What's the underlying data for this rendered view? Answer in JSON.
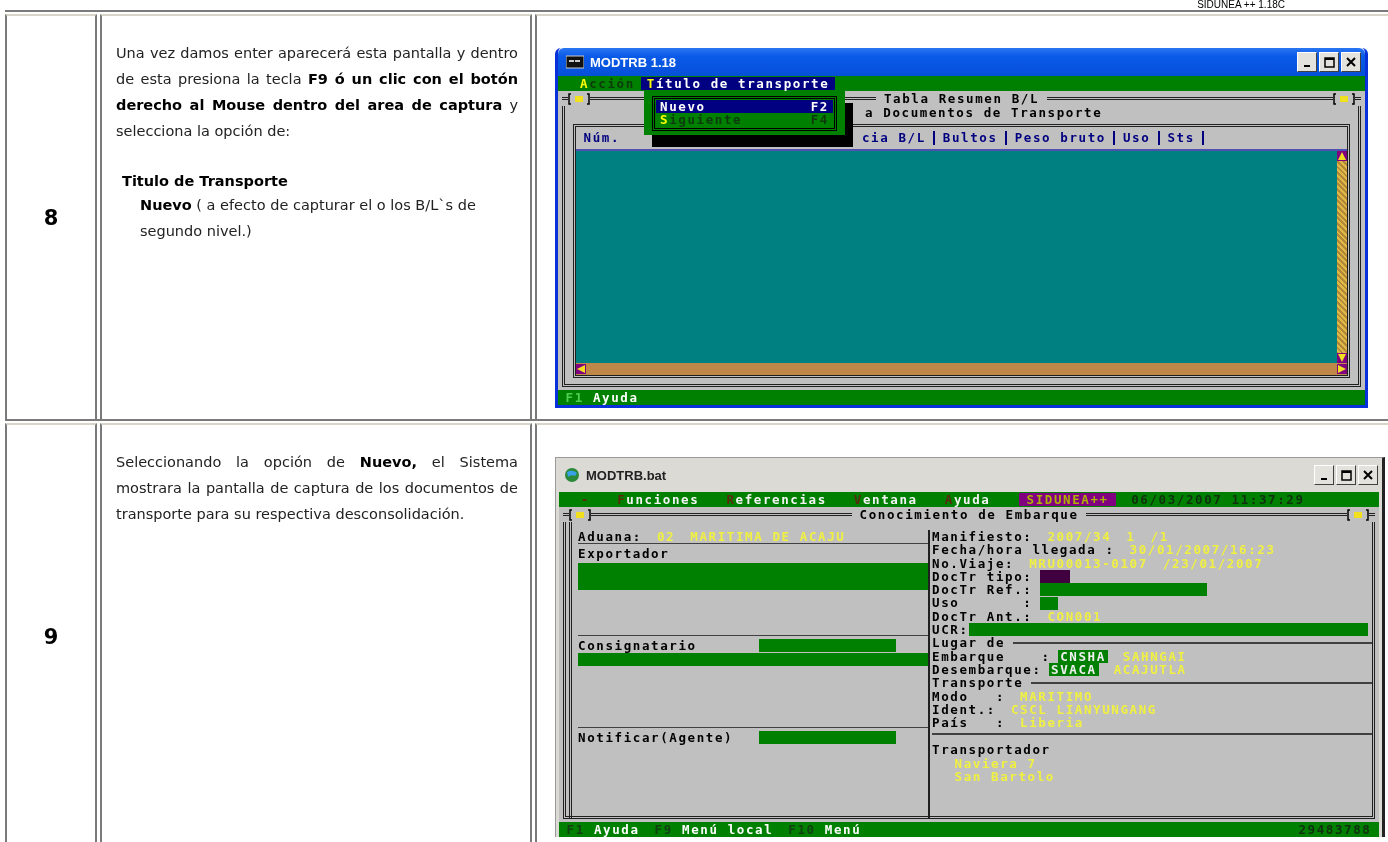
{
  "page_header": "SIDUNEA ++ 1.18C",
  "steps": [
    {
      "number": "8",
      "intro": "Una vez damos enter  aparecerá esta pantalla y dentro de esta presiona la tecla **F9 ó un clic con el botón derecho al Mouse dentro del area de captura** y selecciona la opción de:",
      "option_heading": "Titulo de Transporte",
      "option_detail": "**Nuevo** ( a efecto de capturar el o los B/L`s  de segundo nivel.)",
      "screen": {
        "kind": "table",
        "active": true,
        "title": "MODTRB 1.18",
        "menu": [
          {
            "label": "Acción",
            "selected": false
          },
          {
            "label": "Título de transporte",
            "selected": true
          }
        ],
        "dropdown": [
          {
            "label": "Nuevo",
            "shortcut": "F2",
            "selected": true
          },
          {
            "label": "Siguiente",
            "shortcut": "F4",
            "selected": false
          }
        ],
        "frame_title": "Tabla Resumen B/L",
        "subtitle": "a Documentos de Transporte",
        "columns": [
          "Núm.",
          "cia B/L",
          "Bultos",
          "Peso bruto",
          "Uso",
          "Sts"
        ],
        "status": [
          {
            "key": "F1",
            "label": "Ayuda"
          }
        ]
      }
    },
    {
      "number": "9",
      "intro": "Seleccionando la opción de **Nuevo,** el Sistema mostrara la pantalla de captura de los documentos de transporte para su respectiva desconsolidación.",
      "screen": {
        "kind": "form",
        "active": false,
        "title": "MODTRB.bat",
        "menu": [
          {
            "label": "-",
            "selected": false
          },
          {
            "label": "Funciones",
            "selected": false
          },
          {
            "label": "Referencias",
            "selected": false
          },
          {
            "label": "Ventana",
            "selected": false
          },
          {
            "label": "Ayuda",
            "selected": false
          }
        ],
        "badge": "SIDUNEA++",
        "datetime": "06/03/2007 11:37:29",
        "frame_title": "Conocimiento de Embarque",
        "left": [
          {
            "kind": "value",
            "label": "Aduana:",
            "values": [
              "02",
              "MARITIMA DE ACAJU"
            ]
          },
          {
            "kind": "party",
            "label": "Exportador",
            "fields": [
              {
                "kind": "double-bar"
              }
            ]
          },
          {
            "kind": "party",
            "label": "Consignatario",
            "fields": [
              {
                "kind": "inline-field"
              },
              {
                "kind": "bar"
              }
            ]
          },
          {
            "kind": "party",
            "label": "Notificar(Agente)",
            "fields": [
              {
                "kind": "inline-field"
              }
            ]
          }
        ],
        "right": [
          {
            "kind": "value",
            "label": "Manifiesto:",
            "values": [
              "2007/34",
              "1",
              "/1"
            ]
          },
          {
            "kind": "value",
            "label": "Fecha/hora llegada :",
            "values": [
              "30/01/2007/16:23"
            ]
          },
          {
            "kind": "value",
            "label": "No.Viaje:",
            "values": [
              "MRU00013-0107",
              "/23/01/2007"
            ]
          },
          {
            "kind": "short-field",
            "label": "DocTr tipo:",
            "color": "#400040"
          },
          {
            "kind": "medium-field",
            "label": "DocTr Ref.:",
            "color": "#008000"
          },
          {
            "kind": "tiny-field",
            "label": "Uso       :",
            "color": "#008000"
          },
          {
            "kind": "value",
            "label": "DocTr Ant.:",
            "values": [
              "CON001"
            ]
          },
          {
            "kind": "full-field",
            "label": "UCR:",
            "color": "#008000"
          },
          {
            "kind": "section",
            "label": "Lugar de"
          },
          {
            "kind": "place",
            "label": "Embarque    :",
            "code": "CNSHA",
            "value": "SAHNGAI"
          },
          {
            "kind": "place",
            "label": "Desembarque:",
            "code": "SVACA",
            "value": "ACAJUTLA"
          },
          {
            "kind": "section",
            "label": "Transporte"
          },
          {
            "kind": "value",
            "label": "Modo   :",
            "values": [
              "MARITIMO"
            ]
          },
          {
            "kind": "value",
            "label": "Ident.:",
            "values": [
              "CSCL LIANYUNGANG"
            ]
          },
          {
            "kind": "value",
            "label": "País   :",
            "values": [
              "Liberia"
            ]
          },
          {
            "kind": "group",
            "label": "Transportador",
            "lines": [
              "Naviera 7",
              "San Bartolo"
            ]
          }
        ],
        "status": [
          {
            "key": "F1",
            "label": "Ayuda"
          },
          {
            "key": "F9",
            "label": "Menú local"
          },
          {
            "key": "F10",
            "label": "Menú"
          }
        ],
        "counter": "29483788"
      }
    }
  ]
}
